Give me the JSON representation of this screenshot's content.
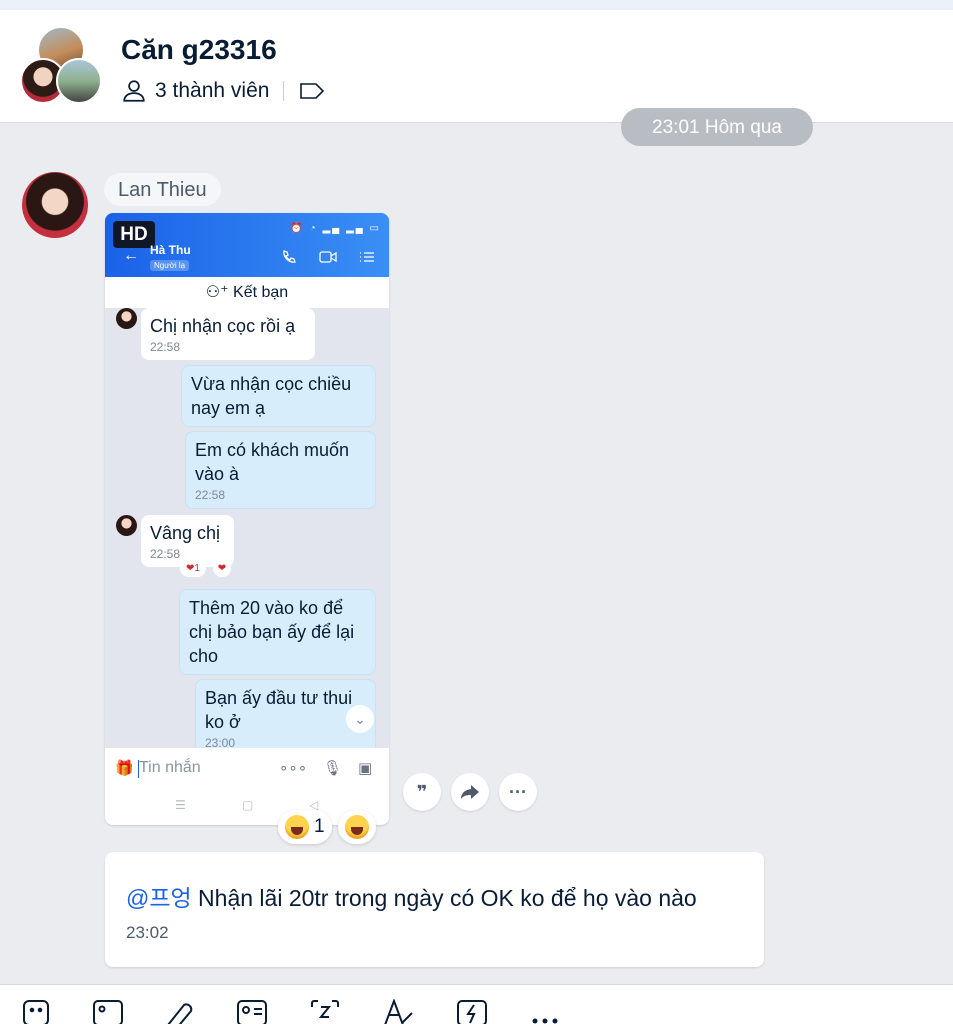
{
  "header": {
    "group_name": "Căn g23316",
    "members": "3 thành viên"
  },
  "time_separator": "23:01 Hôm qua",
  "sender": {
    "name": "Lan Thieu"
  },
  "screenshot": {
    "hd_badge": "HD",
    "contact_name": "Hà Thu",
    "contact_tag": "Người lạ",
    "add_friend": "Kết bạn",
    "messages": [
      {
        "text": "Chị nhận cọc rồi ạ",
        "time": "22:58"
      },
      {
        "text": "Vừa nhận cọc chiều nay em ạ",
        "time": ""
      },
      {
        "text": "Em có khách muốn vào à",
        "time": "22:58"
      },
      {
        "text": "Vâng chị",
        "time": "22:58"
      },
      {
        "text": "Thêm 20 vào ko để chị bảo bạn ấy để lại cho",
        "time": ""
      },
      {
        "text": "Bạn ấy đầu tư thui ko ở",
        "time": "23:00"
      }
    ],
    "mini_reaction_count": "1",
    "input_placeholder": "Tin nhắn"
  },
  "reactions": {
    "count": "1"
  },
  "message2": {
    "mention": "@프엉",
    "text": " Nhận lãi 20tr trong ngày có OK ko để họ vào nào",
    "time": "23:02"
  }
}
